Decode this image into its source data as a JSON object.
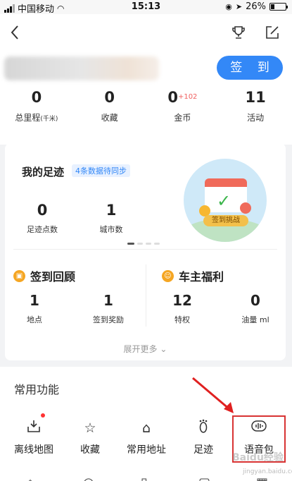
{
  "status_bar": {
    "carrier": "中国移动",
    "time": "15:13",
    "battery": "26%"
  },
  "header": {
    "signin_label": "签 到",
    "stats": [
      {
        "value": "0",
        "label": "总里程",
        "unit": "(千米)"
      },
      {
        "value": "0",
        "label": "收藏"
      },
      {
        "value": "0",
        "bonus": "+102",
        "label": "金币"
      },
      {
        "value": "11",
        "label": "活动"
      }
    ]
  },
  "footprint": {
    "title": "我的足迹",
    "sync_badge": "4条数据待同步",
    "stats": [
      {
        "value": "0",
        "label": "足迹点数"
      },
      {
        "value": "1",
        "label": "城市数"
      }
    ],
    "challenge_label": "签到挑战"
  },
  "checkin_review": {
    "title": "签到回顾",
    "stats": [
      {
        "value": "1",
        "label": "地点"
      },
      {
        "value": "1",
        "label": "签到奖励"
      }
    ]
  },
  "owner_benefits": {
    "title": "车主福利",
    "stats": [
      {
        "value": "12",
        "label": "特权"
      },
      {
        "value": "0",
        "label": "油量 ml"
      }
    ]
  },
  "expand_more": "展开更多",
  "common_functions": {
    "title": "常用功能",
    "items": [
      {
        "label": "离线地图",
        "icon": "download-map-icon"
      },
      {
        "label": "收藏",
        "icon": "star-icon"
      },
      {
        "label": "常用地址",
        "icon": "home-address-icon"
      },
      {
        "label": "足迹",
        "icon": "footprint-icon"
      },
      {
        "label": "语音包",
        "icon": "voice-pack-icon"
      }
    ]
  },
  "watermark": {
    "text": "Baidu经验",
    "url": "jingyan.baidu.com"
  },
  "colors": {
    "accent": "#3388f7",
    "highlight": "#d83333",
    "arrow": "#e02020"
  }
}
